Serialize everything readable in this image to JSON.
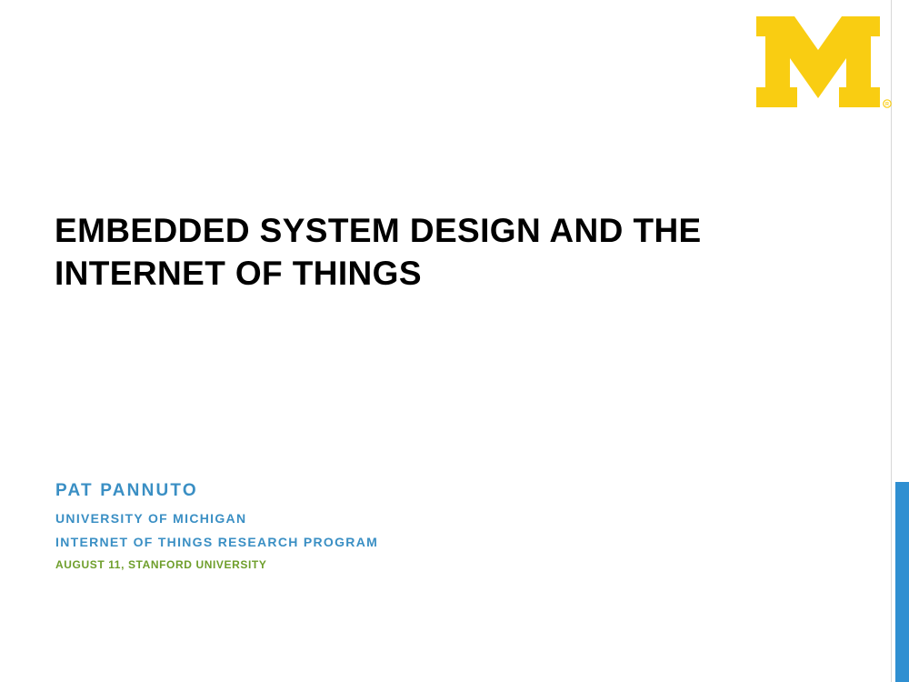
{
  "slide": {
    "title_lines": [
      "EMBEDDED SYSTEM DESIGN AND THE",
      "INTERNET OF THINGS"
    ],
    "author": "PAT PANNUTO",
    "affiliation_1": "UNIVERSITY OF MICHIGAN",
    "affiliation_2": "INTERNET OF THINGS RESEARCH PROGRAM",
    "date_location": "AUGUST 11, STANFORD UNIVERSITY"
  },
  "logo": {
    "icon": "university-of-michigan-block-m-logo",
    "text": "M",
    "registered_mark": "®"
  },
  "colors": {
    "title": "#000000",
    "subtitle_blue": "#3a8fc4",
    "date_green": "#6e9e2b",
    "logo_maize": "#f9cd12",
    "accent_bar": "#2f8fd1"
  }
}
